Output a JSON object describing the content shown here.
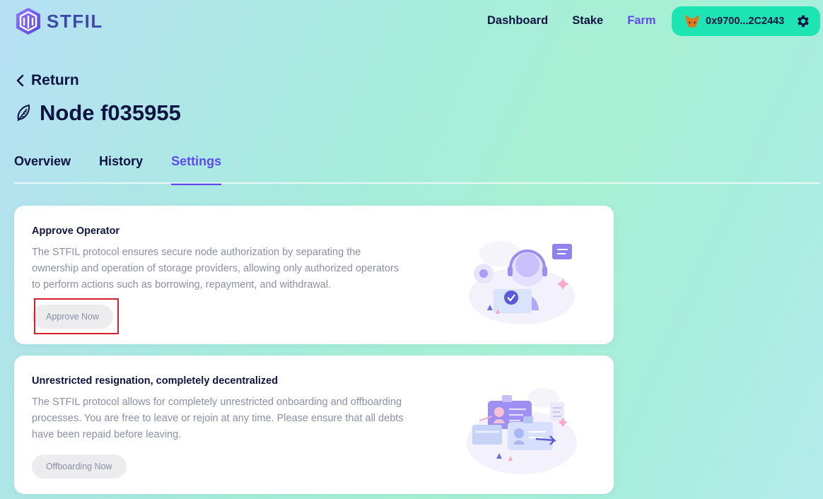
{
  "header": {
    "brand": "STFIL",
    "nav": [
      {
        "label": "Dashboard",
        "active": false
      },
      {
        "label": "Stake",
        "active": false
      },
      {
        "label": "Farm",
        "active": true
      }
    ],
    "wallet_address": "0x9700...2C2443",
    "wallet_icon": "metamask-fox-icon",
    "settings_icon": "gear-icon"
  },
  "page": {
    "return_label": "Return",
    "title": "Node f035955",
    "title_icon": "leaf-icon"
  },
  "tabs": [
    {
      "label": "Overview",
      "active": false
    },
    {
      "label": "History",
      "active": false
    },
    {
      "label": "Settings",
      "active": true
    }
  ],
  "cards": [
    {
      "title": "Approve Operator",
      "description": "The STFIL protocol ensures secure node authorization by separating the ownership and operation of storage providers, allowing only authorized operators to perform actions such as borrowing, repayment, and withdrawal.",
      "button_label": "Approve Now",
      "illustration": "support-operator-illustration"
    },
    {
      "title": "Unrestricted resignation, completely decentralized",
      "description": "The STFIL protocol allows for completely unrestricted onboarding and offboarding processes. You are free to leave or rejoin at any time. Please ensure that all debts have been repaid before leaving.",
      "button_label": "Offboarding Now",
      "illustration": "id-cards-illustration"
    }
  ],
  "colors": {
    "accent": "#5d4bf0",
    "wallet_bg": "#1ee3b3",
    "text_dark": "#0e1442",
    "text_muted": "#8a8fa6",
    "highlight_box": "#d61f2c"
  }
}
